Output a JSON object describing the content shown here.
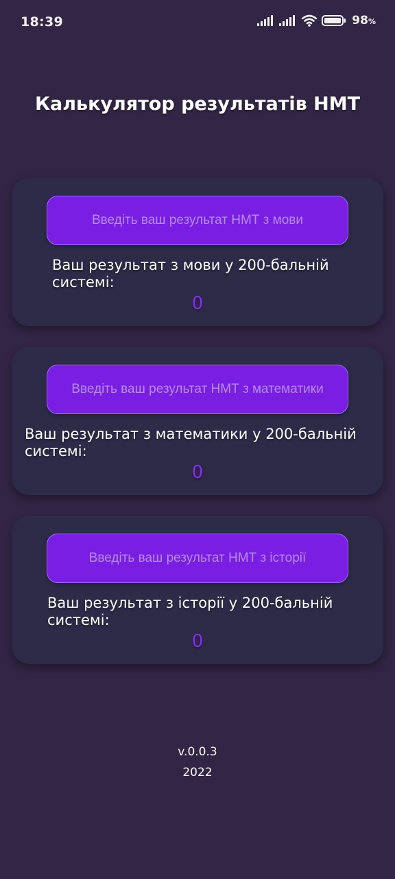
{
  "status_bar": {
    "time": "18:39",
    "battery_percent": "98",
    "battery_unit": "%"
  },
  "app": {
    "title": "Калькулятор результатів НМТ"
  },
  "cards": [
    {
      "input_placeholder": "Введіть ваш результат НМТ з мови",
      "label": "Ваш результат з мови у 200-бальній системі:",
      "value": "0"
    },
    {
      "input_placeholder": "Введіть ваш результат НМТ з математики",
      "label": "Ваш результат з математики у 200-бальній системі:",
      "value": "0"
    },
    {
      "input_placeholder": "Введіть ваш результат НМТ з історії",
      "label": "Ваш результат з історії у 200-бальній системі:",
      "value": "0"
    }
  ],
  "footer": {
    "version": "v.0.0.3",
    "year": "2022"
  },
  "colors": {
    "background": "#332545",
    "card": "#2d2b48",
    "input_fill": "#7a1ee3",
    "input_border": "#9b6cff",
    "placeholder_text": "#b58cf0",
    "score_value": "#8a2cf0"
  },
  "icons": [
    "signal-icon",
    "signal-icon-2",
    "wifi-icon",
    "battery-icon"
  ]
}
